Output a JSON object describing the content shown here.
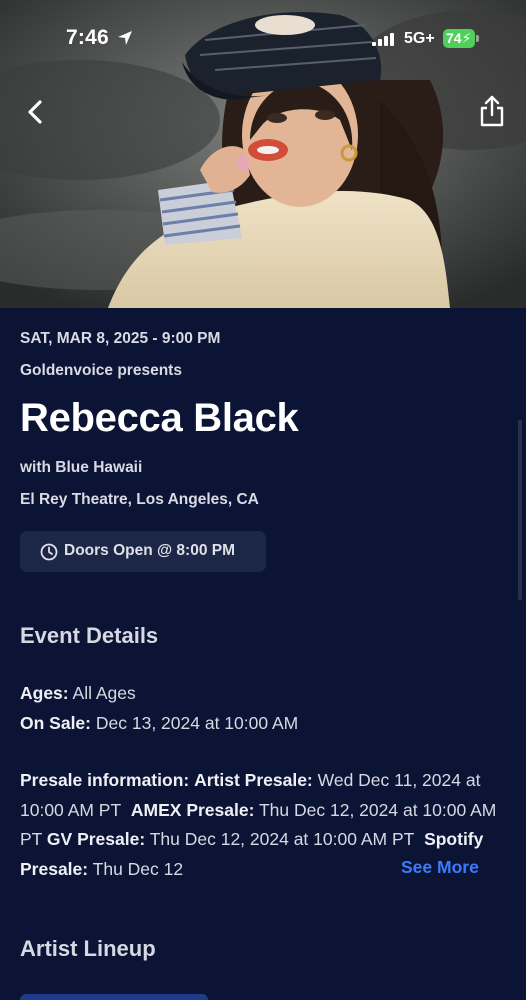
{
  "status_bar": {
    "time": "7:46",
    "network": "5G+",
    "battery": "74"
  },
  "icons": {
    "back": "chevron-left-icon",
    "share": "share-icon",
    "clock": "clock-icon",
    "location": "location-arrow-icon",
    "signal": "signal-bars-icon"
  },
  "event": {
    "date_time": "SAT, MAR 8, 2025 - 9:00 PM",
    "presenter": "Goldenvoice presents",
    "title": "Rebecca Black",
    "support": "with Blue Hawaii",
    "venue": "El Rey Theatre, Los Angeles, CA",
    "doors": "Doors Open @ 8:00 PM"
  },
  "details": {
    "heading": "Event Details",
    "ages_label": "Ages:",
    "ages_value": "All Ages",
    "on_sale_label": "On Sale:",
    "on_sale_value": "Dec 13, 2024 at 10:00 AM",
    "presale_label": "Presale information:",
    "presales": [
      {
        "name": "Artist Presale:",
        "when": "Wed Dec 11, 2024 at 10:00 AM PT"
      },
      {
        "name": "AMEX Presale:",
        "when": "Thu Dec 12, 2024 at 10:00 AM PT"
      },
      {
        "name": "GV Presale:",
        "when": "Thu Dec 12, 2024 at 10:00 AM PT"
      },
      {
        "name": "Spotify Presale:",
        "when": "Thu Dec 12"
      }
    ],
    "see_more": "See More"
  },
  "lineup": {
    "heading": "Artist Lineup"
  },
  "colors": {
    "background": "#0b1434",
    "pill": "#1c2646",
    "link": "#3a7bff",
    "battery": "#4fd05a"
  }
}
